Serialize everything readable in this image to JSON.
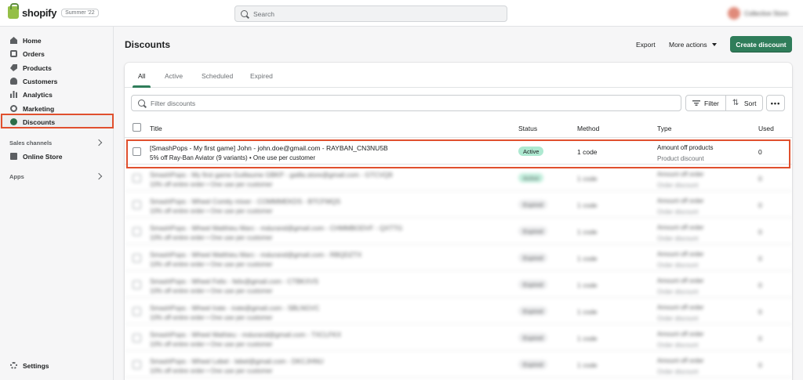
{
  "topbar": {
    "brand": "shopify",
    "season_badge": "Summer '22",
    "search_placeholder": "Search",
    "user_name": "Collective Store"
  },
  "sidebar": {
    "items": [
      {
        "label": "Home",
        "icon": "home-icon"
      },
      {
        "label": "Orders",
        "icon": "orders-icon"
      },
      {
        "label": "Products",
        "icon": "tag-icon"
      },
      {
        "label": "Customers",
        "icon": "person-icon"
      },
      {
        "label": "Analytics",
        "icon": "bar-chart-icon"
      },
      {
        "label": "Marketing",
        "icon": "target-icon"
      },
      {
        "label": "Discounts",
        "icon": "discount-icon"
      }
    ],
    "sales_channels_label": "Sales channels",
    "online_store_label": "Online Store",
    "apps_label": "Apps",
    "settings_label": "Settings"
  },
  "page": {
    "title": "Discounts",
    "export_label": "Export",
    "more_actions_label": "More actions",
    "create_label": "Create discount"
  },
  "tabs": [
    "All",
    "Active",
    "Scheduled",
    "Expired"
  ],
  "filter": {
    "placeholder": "Filter discounts",
    "filter_label": "Filter",
    "sort_label": "Sort",
    "more_label": "•••"
  },
  "table": {
    "headers": [
      "Title",
      "Status",
      "Method",
      "Type",
      "Used"
    ],
    "rows": [
      {
        "title": "[SmashPops - My first game] John - john.doe@gmail.com - RAYBAN_CN3NU5B",
        "subtitle": "5% off Ray-Ban Aviator (9 variants) • One use per customer",
        "status": "Active",
        "method": "1 code",
        "type": "Amount off products",
        "type_sub": "Product discount",
        "used": "0"
      },
      {
        "title": "SmashPops - My first game Guillaume GBKP - gailla.store@gmail.com - GTCVQ9",
        "subtitle": "10% off entire order • One use per customer",
        "status": "Active",
        "method": "1 code",
        "type": "Amount off order",
        "type_sub": "Order discount",
        "used": "0"
      },
      {
        "title": "SmashPops - Wheel Comity mixer - COMMMEKDS - BTCFMQS",
        "subtitle": "10% off entire order • One use per customer",
        "status": "Expired",
        "method": "1 code",
        "type": "Amount off order",
        "type_sub": "Order discount",
        "used": "0"
      },
      {
        "title": "SmashPops - Wheel Matthieu Marc - mdurand@gmail.com - CHMMBODVF - QXTTG",
        "subtitle": "10% off entire order • One use per customer",
        "status": "Expired",
        "method": "1 code",
        "type": "Amount off order",
        "type_sub": "Order discount",
        "used": "0"
      },
      {
        "title": "SmashPops - Wheel Matthieu Marc - mdurand@gmail.com - RBQDZTX",
        "subtitle": "10% off entire order • One use per customer",
        "status": "Expired",
        "method": "1 code",
        "type": "Amount off order",
        "type_sub": "Order discount",
        "used": "0"
      },
      {
        "title": "SmashPops - Wheel Felix - felix@gmail.com - CTBKXVS",
        "subtitle": "10% off entire order • One use per customer",
        "status": "Expired",
        "method": "1 code",
        "type": "Amount off order",
        "type_sub": "Order discount",
        "used": "0"
      },
      {
        "title": "SmashPops - Wheel Irate - irate@gmail.com - SBLNGVC",
        "subtitle": "10% off entire order • One use per customer",
        "status": "Expired",
        "method": "1 code",
        "type": "Amount off order",
        "type_sub": "Order discount",
        "used": "0"
      },
      {
        "title": "SmashPops - Wheel Mathieu - mdurand@gmail.com - TXCLFKX",
        "subtitle": "10% off entire order • One use per customer",
        "status": "Expired",
        "method": "1 code",
        "type": "Amount off order",
        "type_sub": "Order discount",
        "used": "0"
      },
      {
        "title": "SmashPops - Wheel Lebel - lebel@gmail.com - DKCJHNU",
        "subtitle": "10% off entire order • One use per customer",
        "status": "Expired",
        "method": "1 code",
        "type": "Amount off order",
        "type_sub": "Order discount",
        "used": "0"
      }
    ]
  },
  "colors": {
    "accent": "#2f7d5a",
    "highlight": "#e0502e",
    "badge_active": "#aee9d1"
  }
}
